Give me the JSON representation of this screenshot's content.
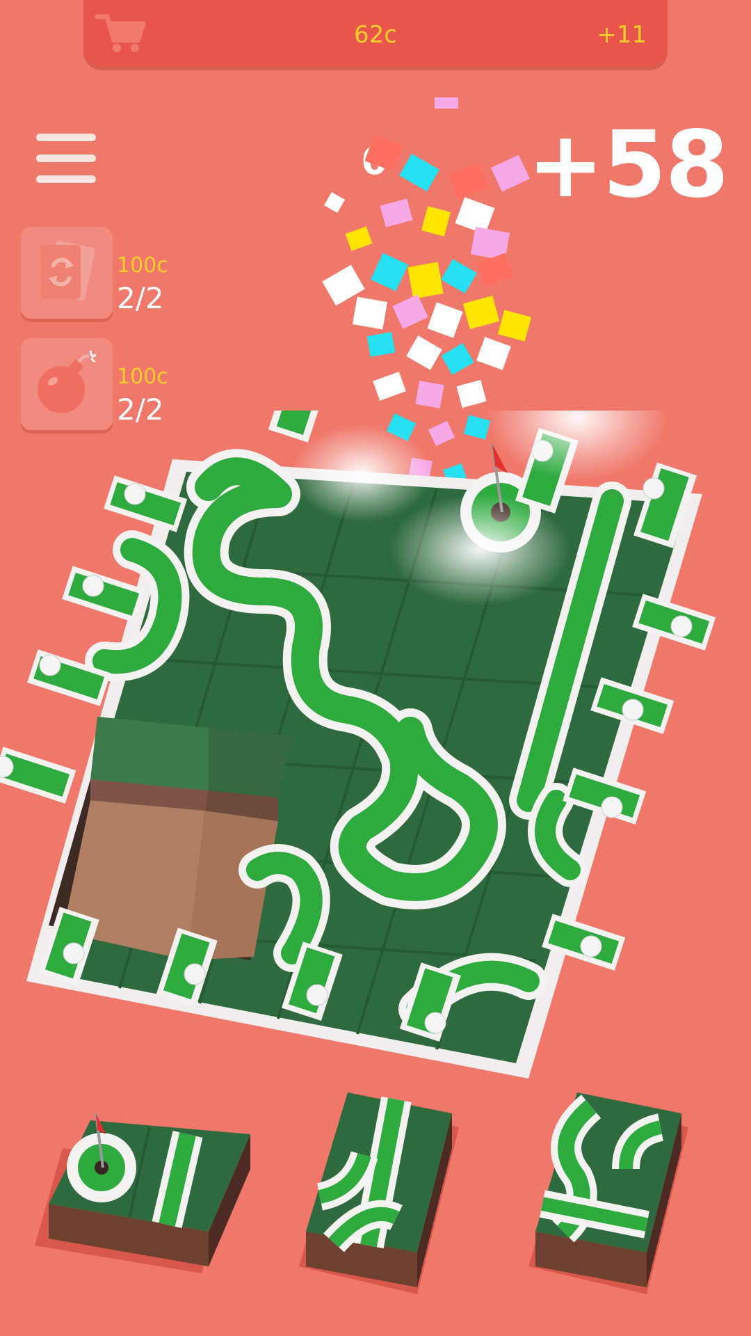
{
  "header": {
    "coins": "62c",
    "bonus": "+11",
    "cart_icon": "cart-icon"
  },
  "menu": {
    "icon": "hamburger-menu-icon"
  },
  "powerups": [
    {
      "name": "shuffle-cards",
      "icon": "shuffle-cards-icon",
      "cost": "100c",
      "count": "2/2"
    },
    {
      "name": "bomb",
      "icon": "bomb-icon",
      "cost": "100c",
      "count": "2/2"
    }
  ],
  "score": {
    "current": "0",
    "bonus": "+58"
  },
  "colors": {
    "background": "#ef786b",
    "header": "#e8564b",
    "coin_text": "#ffcc2e",
    "track_green": "#2eaa3f",
    "tile_dark_green": "#2f6a3e",
    "dirt": "#9b6e50"
  },
  "tray_pieces": [
    {
      "name": "hole-and-straight-piece"
    },
    {
      "name": "straight-and-curves-piece"
    },
    {
      "name": "curves-piece"
    }
  ]
}
